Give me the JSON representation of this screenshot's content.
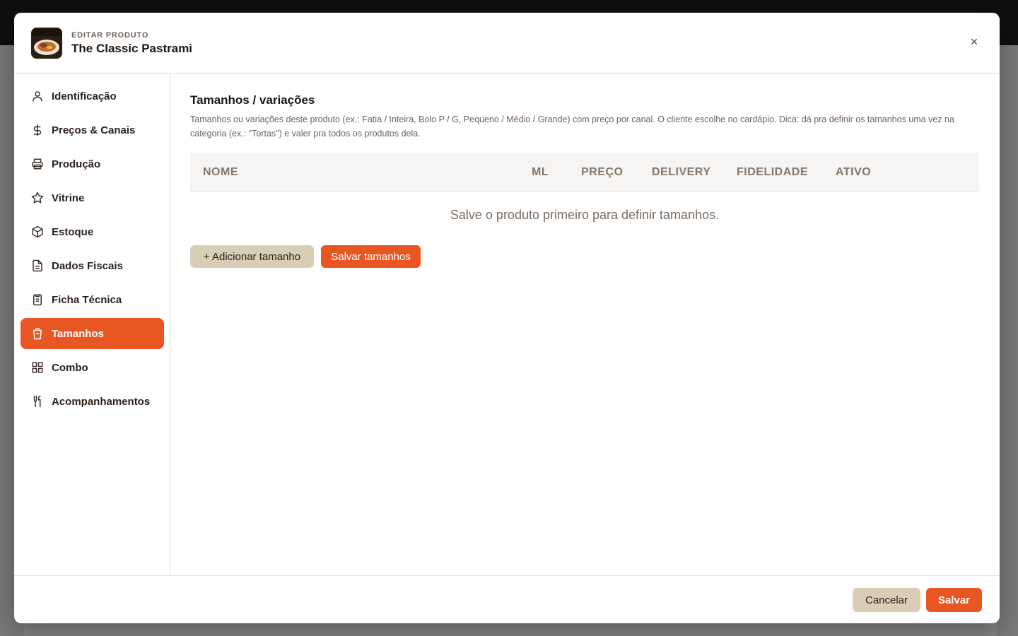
{
  "header": {
    "eyebrow": "EDITAR PRODUTO",
    "title": "The Classic Pastrami",
    "close_label": "×"
  },
  "sidebar": {
    "items": [
      {
        "label": "Identificação",
        "icon": "user-icon"
      },
      {
        "label": "Preços & Canais",
        "icon": "dollar-icon"
      },
      {
        "label": "Produção",
        "icon": "printer-icon"
      },
      {
        "label": "Vitrine",
        "icon": "star-icon"
      },
      {
        "label": "Estoque",
        "icon": "box-icon"
      },
      {
        "label": "Dados Fiscais",
        "icon": "document-icon"
      },
      {
        "label": "Ficha Técnica",
        "icon": "clipboard-icon"
      },
      {
        "label": "Tamanhos",
        "icon": "cup-icon",
        "active": true
      },
      {
        "label": "Combo",
        "icon": "grid-icon"
      },
      {
        "label": "Acompanhamentos",
        "icon": "utensils-icon"
      }
    ]
  },
  "main": {
    "title": "Tamanhos / variações",
    "description": "Tamanhos ou variações deste produto (ex.: Fatia / Inteira, Bolo P / G, Pequeno / Médio / Grande) com preço por canal. O cliente escolhe no cardápio. Dica: dá pra definir os tamanhos uma vez na categoria (ex.: \"Tortas\") e valer pra todos os produtos dela.",
    "columns": [
      "NOME",
      "ML",
      "PREÇO",
      "DELIVERY",
      "FIDELIDADE",
      "ATIVO"
    ],
    "empty_message": "Salve o produto primeiro para definir tamanhos.",
    "add_button": "+ Adicionar tamanho",
    "save_sizes_button": "Salvar tamanhos"
  },
  "footer": {
    "cancel": "Cancelar",
    "save": "Salvar"
  },
  "colors": {
    "accent": "#e85623",
    "secondary_button": "#d9cdb6"
  }
}
